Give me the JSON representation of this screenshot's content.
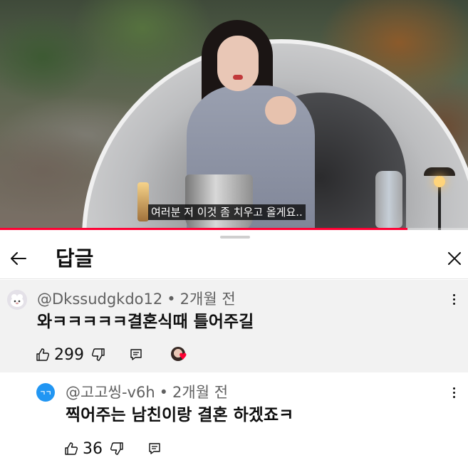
{
  "video": {
    "subtitle": "여러분 저 이것 좀 치우고 올게요..",
    "progress_fraction": 0.87,
    "progress_color": "#ff0033"
  },
  "panel": {
    "title": "답글",
    "back_icon": "arrow-left-icon",
    "close_icon": "close-icon"
  },
  "comment": {
    "author": "@Dkssudgkdo12",
    "separator": "•",
    "time": "2개월 전",
    "text": "와ㅋㅋㅋㅋㅋ결혼식때 틀어주길",
    "likes": "299",
    "creator_heart": true
  },
  "reply": {
    "avatar_text": "ㄱㄱ",
    "avatar_color": "#2196f3",
    "author": "@고고씽-v6h",
    "separator": "•",
    "time": "2개월 전",
    "text": "찍어주는 남친이랑 결혼 하겠죠ㅋ",
    "likes": "36"
  }
}
